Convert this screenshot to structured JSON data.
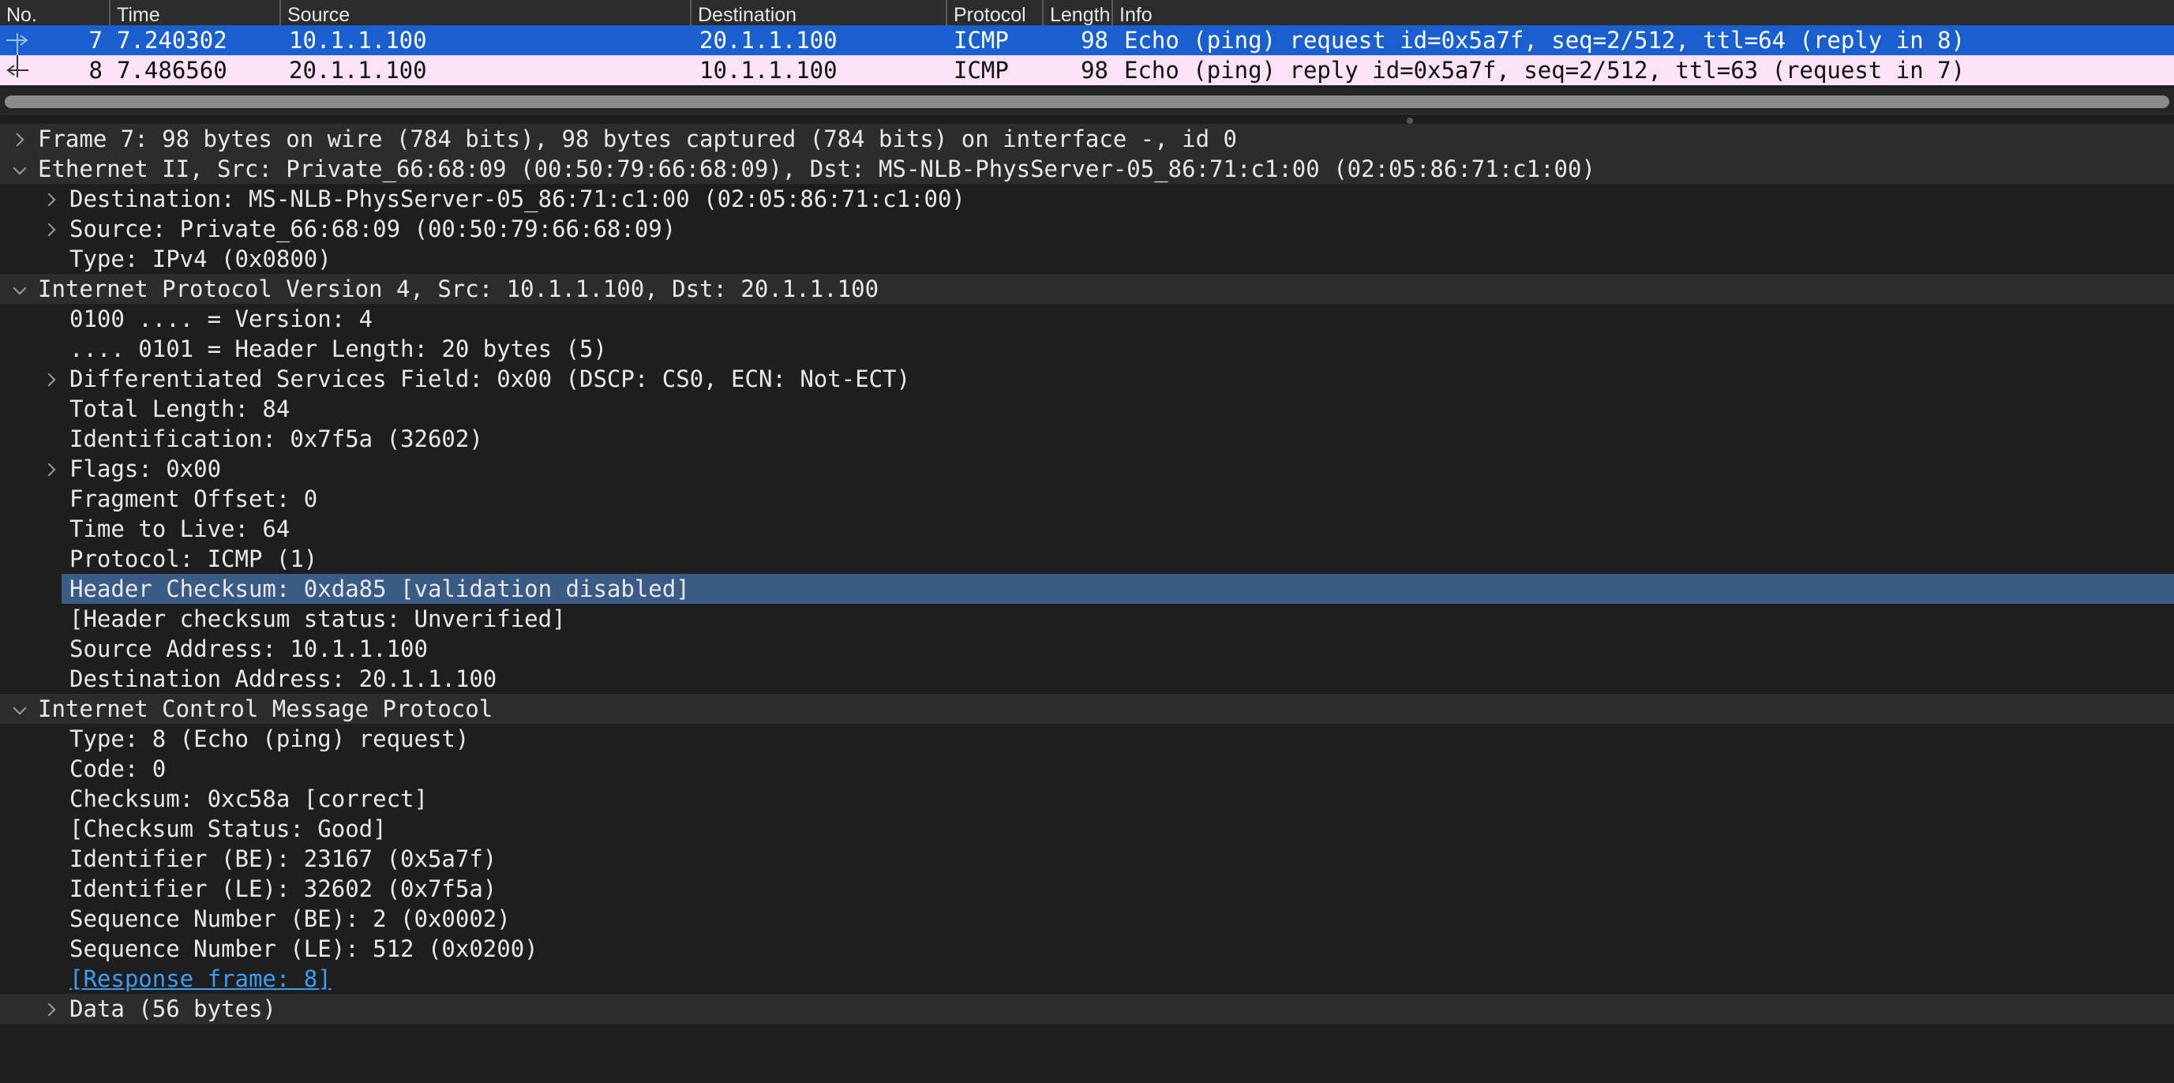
{
  "packet_list": {
    "columns": [
      "No.",
      "Time",
      "Source",
      "Destination",
      "Protocol",
      "Length",
      "Info"
    ],
    "rows": [
      {
        "no": "7",
        "time": "7.240302",
        "source": "10.1.1.100",
        "destination": "20.1.1.100",
        "protocol": "ICMP",
        "length": "98",
        "info": "Echo (ping) request  id=0x5a7f, seq=2/512, ttl=64 (reply in 8)",
        "selected": true
      },
      {
        "no": "8",
        "time": "7.486560",
        "source": "20.1.1.100",
        "destination": "10.1.1.100",
        "protocol": "ICMP",
        "length": "98",
        "info": "Echo (ping) reply    id=0x5a7f, seq=2/512, ttl=63 (request in 7)",
        "selected": false
      }
    ],
    "colors": {
      "selected_row": "#1a5fcf",
      "icmp_row": "#fbe2f4"
    }
  },
  "details": {
    "frame": {
      "label": "Frame 7: 98 bytes on wire (784 bits), 98 bytes captured (784 bits) on interface -, id 0"
    },
    "ethernet": {
      "label": "Ethernet II, Src: Private_66:68:09 (00:50:79:66:68:09), Dst: MS-NLB-PhysServer-05_86:71:c1:00 (02:05:86:71:c1:00)",
      "destination": "Destination: MS-NLB-PhysServer-05_86:71:c1:00 (02:05:86:71:c1:00)",
      "source": "Source: Private_66:68:09 (00:50:79:66:68:09)",
      "type": "Type: IPv4 (0x0800)"
    },
    "ip": {
      "label": "Internet Protocol Version 4, Src: 10.1.1.100, Dst: 20.1.1.100",
      "version": "0100 .... = Version: 4",
      "header_length": ".... 0101 = Header Length: 20 bytes (5)",
      "dsfield": "Differentiated Services Field: 0x00 (DSCP: CS0, ECN: Not-ECT)",
      "total_length": "Total Length: 84",
      "identification": "Identification: 0x7f5a (32602)",
      "flags": "Flags: 0x00",
      "fragment_offset": "Fragment Offset: 0",
      "ttl": "Time to Live: 64",
      "protocol": "Protocol: ICMP (1)",
      "checksum": "Header Checksum: 0xda85 [validation disabled]",
      "checksum_status": "[Header checksum status: Unverified]",
      "src": "Source Address: 10.1.1.100",
      "dst": "Destination Address: 20.1.1.100"
    },
    "icmp": {
      "label": "Internet Control Message Protocol",
      "type": "Type: 8 (Echo (ping) request)",
      "code": "Code: 0",
      "checksum": "Checksum: 0xc58a [correct]",
      "checksum_status": "[Checksum Status: Good]",
      "id_be": "Identifier (BE): 23167 (0x5a7f)",
      "id_le": "Identifier (LE): 32602 (0x7f5a)",
      "seq_be": "Sequence Number (BE): 2 (0x0002)",
      "seq_le": "Sequence Number (LE): 512 (0x0200)",
      "response_frame": "[Response frame: 8]",
      "data": "Data (56 bytes)"
    },
    "colors": {
      "selected_field": "#3a5b85",
      "link": "#3d9df3",
      "band": "#2c2c2c"
    }
  }
}
